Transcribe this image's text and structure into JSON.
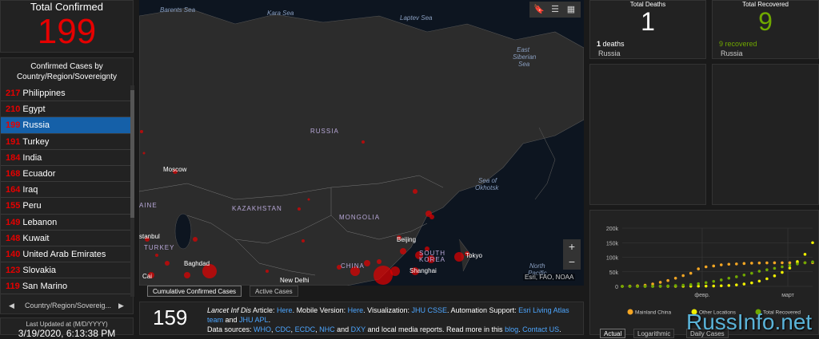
{
  "total": {
    "title": "Total Confirmed",
    "value": "199"
  },
  "list": {
    "title_line1": "Confirmed Cases by",
    "title_line2": "Country/Region/Sovereignty",
    "rows": [
      {
        "num": "217",
        "name": "Philippines"
      },
      {
        "num": "210",
        "name": "Egypt"
      },
      {
        "num": "199",
        "name": "Russia"
      },
      {
        "num": "191",
        "name": "Turkey"
      },
      {
        "num": "184",
        "name": "India"
      },
      {
        "num": "168",
        "name": "Ecuador"
      },
      {
        "num": "164",
        "name": "Iraq"
      },
      {
        "num": "155",
        "name": "Peru"
      },
      {
        "num": "149",
        "name": "Lebanon"
      },
      {
        "num": "148",
        "name": "Kuwait"
      },
      {
        "num": "140",
        "name": "United Arab Emirates"
      },
      {
        "num": "123",
        "name": "Slovakia"
      },
      {
        "num": "119",
        "name": "San Marino"
      }
    ],
    "nav_label": "Country/Region/Sovereig...",
    "nav_prev": "◀",
    "nav_next": "▶"
  },
  "updated": {
    "label": "Last Updated at (M/D/YYYY)",
    "value": "3/19/2020, 6:13:38 PM"
  },
  "map": {
    "labels": {
      "barents": "Barents Sea",
      "kara": "Kara Sea",
      "laptev": "Laptev Sea",
      "east_siberian_1": "East",
      "east_siberian_2": "Siberian",
      "east_siberian_3": "Sea",
      "russia": "RUSSIA",
      "moscow": "Moscow",
      "kazakhstan": "KAZAKHSTAN",
      "mongolia": "MONGOLIA",
      "okhotsk_1": "Sea of",
      "okhotsk_2": "Okhotsk",
      "beijing": "Beijing",
      "south_korea_1": "SOUTH",
      "south_korea_2": "KOREA",
      "tokyo": "Tokyo",
      "shanghai": "Shanghai",
      "china": "CHINA",
      "baghdad": "Baghdad",
      "new_delhi": "New Delhi",
      "turkey": "TURKEY",
      "istanbul": "stanbul",
      "ukraine": "AINE",
      "cairo": "Cai",
      "north_1": "North",
      "north_2": "Pacific"
    },
    "attribution": "Esri, FAO, NOAA",
    "tools": [
      "bookmark",
      "list",
      "qr"
    ],
    "zoom_in": "+",
    "zoom_out": "−"
  },
  "map_tabs": [
    "Cumulative Confirmed Cases",
    "Active Cases"
  ],
  "info": {
    "count": "159",
    "p1_a": "Lancet Inf Dis",
    "p1_b": " Article: ",
    "here1": "Here",
    "p1_c": ". Mobile Version: ",
    "here2": "Here",
    "p1_d": ". Visualization: ",
    "jhu": "JHU CSSE",
    "p1_e": ". Automation Support: ",
    "esri": "Esri Living Atlas team",
    "p1_f": " and ",
    "jhuapl": "JHU APL",
    "p1_g": ".",
    "p2_a": "Data sources: ",
    "who": "WHO",
    "cdc": "CDC",
    "ecdc": "ECDC",
    "nhc": "NHC",
    "p2_b": " and ",
    "dxy": "DXY",
    "p2_c": " and local media reports. Read more in this ",
    "blog": "blog",
    "p2_d": ". ",
    "contact": "Contact US",
    "p2_e": "."
  },
  "deaths": {
    "title": "Total Deaths",
    "value": "1",
    "sub_num": "1",
    "sub_text": " deaths",
    "sub_country": "Russia",
    "color": "#ffffff"
  },
  "recovered": {
    "title": "Total Recovered",
    "value": "9",
    "sub_num": "9",
    "sub_text": " recovered",
    "sub_country": "Russia",
    "color": "#70a800"
  },
  "chart_data": {
    "type": "line",
    "x_ticks": [
      "февр.",
      "март"
    ],
    "y_ticks": [
      "0",
      "50k",
      "100k",
      "150k",
      "200k"
    ],
    "ylim": [
      0,
      200000
    ],
    "series": [
      {
        "name": "Mainland China",
        "color": "#f5a623",
        "values": [
          0,
          1000,
          2000,
          4000,
          8000,
          14000,
          20000,
          28000,
          37000,
          45000,
          60000,
          67000,
          70000,
          74000,
          76000,
          77000,
          78500,
          79800,
          80400,
          80700,
          80900,
          81000,
          81000,
          81000,
          81100,
          81200
        ]
      },
      {
        "name": "Other Locations",
        "color": "#f0f000",
        "values": [
          0,
          0,
          0,
          0,
          100,
          200,
          300,
          400,
          500,
          600,
          700,
          900,
          1200,
          2000,
          3000,
          5000,
          8000,
          12000,
          18000,
          26000,
          36000,
          48000,
          63000,
          85000,
          110000,
          150000
        ]
      },
      {
        "name": "Total Recovered",
        "color": "#70a800",
        "values": [
          0,
          0,
          0,
          100,
          300,
          800,
          1500,
          2500,
          4000,
          6000,
          9000,
          13000,
          17000,
          22000,
          28000,
          33000,
          39000,
          45000,
          52000,
          57000,
          62000,
          67000,
          72000,
          77000,
          81000,
          84000
        ]
      }
    ]
  },
  "chart_tabs": [
    "Actual",
    "Logarithmic",
    "Daily Cases"
  ],
  "watermark": "RussInfo.net"
}
